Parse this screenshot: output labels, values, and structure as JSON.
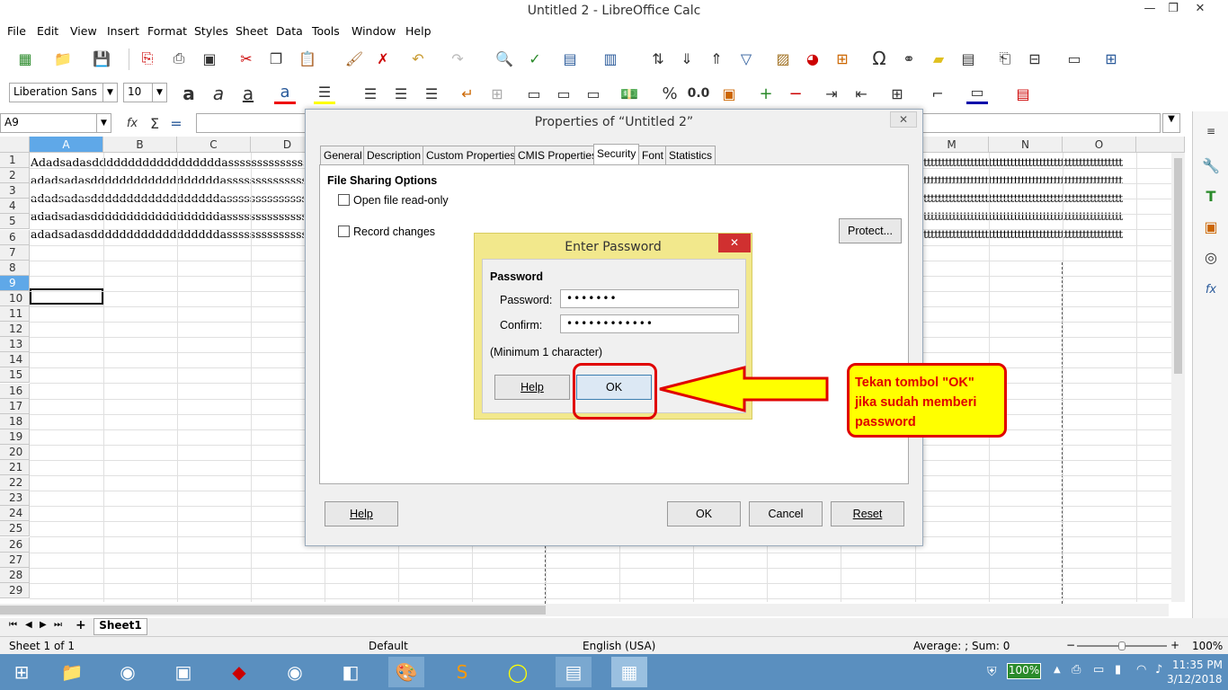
{
  "window": {
    "title": "Untitled 2 - LibreOffice Calc"
  },
  "menu": [
    "File",
    "Edit",
    "View",
    "Insert",
    "Format",
    "Styles",
    "Sheet",
    "Data",
    "Tools",
    "Window",
    "Help"
  ],
  "font_name": "Liberation Sans",
  "font_size": "10",
  "name_box": "A9",
  "columns": [
    "A",
    "B",
    "C",
    "D",
    "M",
    "N",
    "O"
  ],
  "rows": [
    "1",
    "2",
    "3",
    "4",
    "5",
    "6",
    "7",
    "8",
    "9",
    "10",
    "11",
    "12",
    "13",
    "14",
    "15",
    "16",
    "17",
    "18",
    "19",
    "20",
    "21",
    "22",
    "23",
    "24",
    "25",
    "26",
    "27",
    "28",
    "29"
  ],
  "cells": {
    "r1": "Adadsadasddddddddddddddddddasssssssssssssss",
    "r2": "adadsadasddddddddddddddddddasssssssssssssss",
    "r3": "adadsadasddddddddddddddddddasssssssssssssss",
    "r4": "adadsadasddddddddddddddddddasssssssssssssss",
    "r5": "adadsadasddddddddddddddddddasssssssssssssss",
    "right": "ttttttttttttttttttttttttttttttttttttttttttttttttttttttt"
  },
  "sheet_tab": "Sheet1",
  "status": {
    "sheet": "Sheet 1 of 1",
    "style": "Default",
    "lang": "English (USA)",
    "sum": "Average: ; Sum: 0",
    "zoom": "100%"
  },
  "props": {
    "title": "Properties of “Untitled 2”",
    "tabs": [
      "General",
      "Description",
      "Custom Properties",
      "CMIS Properties",
      "Security",
      "Font",
      "Statistics"
    ],
    "section": "File Sharing Options",
    "readonly": "Open file read-only",
    "record": "Record changes",
    "protect": "Protect...",
    "help": "Help",
    "ok": "OK",
    "cancel": "Cancel",
    "reset": "Reset"
  },
  "pwd": {
    "title": "Enter Password",
    "section": "Password",
    "pw_label": "Password:",
    "pw_value": "•••••••",
    "confirm_label": "Confirm:",
    "confirm_value": "••••••••••••",
    "min": "(Minimum 1 character)",
    "help": "Help",
    "ok": "OK"
  },
  "annotation": "Tekan tombol \"OK\" jika sudah memberi password",
  "taskbar": {
    "battery": "100%",
    "time": "11:35 PM",
    "date": "3/12/2018"
  },
  "colors": {
    "accent": "#e00000",
    "annotation_bg": "#ffff00",
    "taskbar": "#5a8fbf"
  }
}
